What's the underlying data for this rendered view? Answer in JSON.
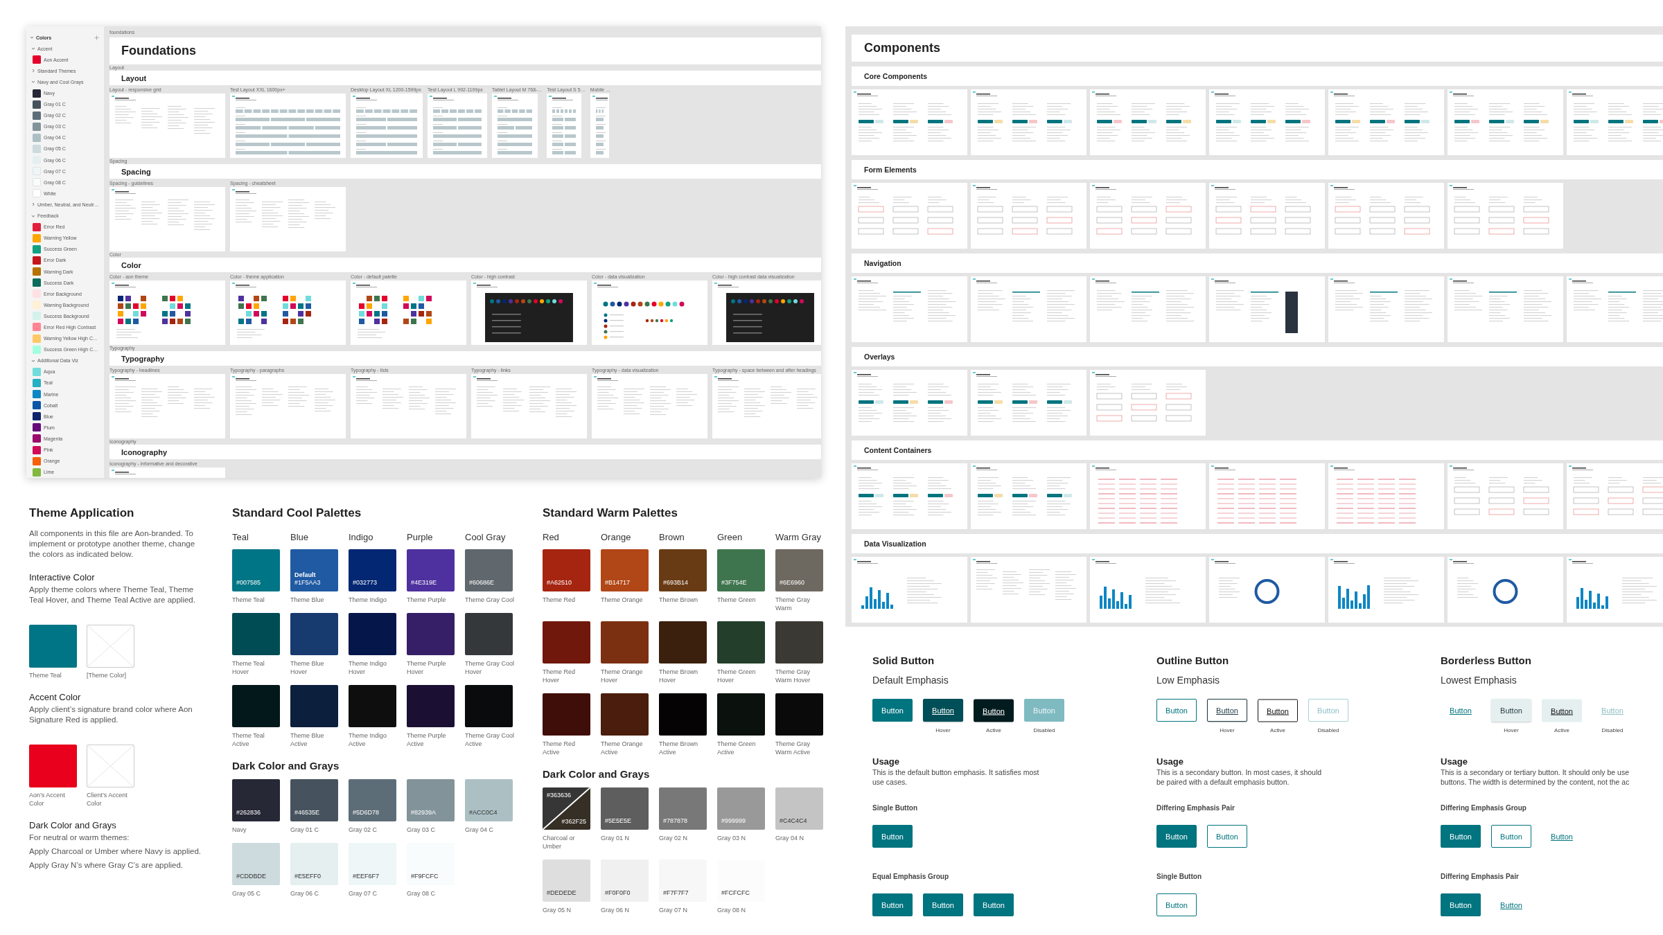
{
  "sidebar": {
    "title": "Colors",
    "expanded": true,
    "groups": [
      {
        "label": "Accent",
        "expanded": true,
        "items": [
          {
            "name": "Aon Accent",
            "color": "#e4002b"
          }
        ]
      },
      {
        "label": "Standard Themes",
        "expanded": false
      },
      {
        "label": "Navy and Cool Grays",
        "expanded": true,
        "items": [
          {
            "name": "Navy",
            "color": "#262836"
          },
          {
            "name": "Gray 01 C",
            "color": "#46535e"
          },
          {
            "name": "Gray 02 C",
            "color": "#5d6d78"
          },
          {
            "name": "Gray 03 C",
            "color": "#82939a"
          },
          {
            "name": "Gray 04 C",
            "color": "#acc0c4"
          },
          {
            "name": "Gray 05 C",
            "color": "#cddbde"
          },
          {
            "name": "Gray 06 C",
            "color": "#e5eff0"
          },
          {
            "name": "Gray 07 C",
            "color": "#eef6f7"
          },
          {
            "name": "Gray 08 C",
            "color": "#f9fcfc"
          },
          {
            "name": "White",
            "color": "#ffffff"
          }
        ]
      },
      {
        "label": "Umber, Neutral, and Neutr…",
        "expanded": false
      },
      {
        "label": "Feedback",
        "expanded": true,
        "items": [
          {
            "name": "Error Red",
            "color": "#e11f3c"
          },
          {
            "name": "Warning Yellow",
            "color": "#ffa600"
          },
          {
            "name": "Success Green",
            "color": "#12a182"
          },
          {
            "name": "Error Dark",
            "color": "#c4151c"
          },
          {
            "name": "Warning Dark",
            "color": "#b67300"
          },
          {
            "name": "Success Dark",
            "color": "#0b6e5c"
          },
          {
            "name": "Error Background",
            "color": "#fde1e3"
          },
          {
            "name": "Warning Background",
            "color": "#fff0d6"
          },
          {
            "name": "Success Background",
            "color": "#d3f2eb"
          },
          {
            "name": "Error Red High Contrast",
            "color": "#ff8593"
          },
          {
            "name": "Warning Yellow High C…",
            "color": "#ffc866"
          },
          {
            "name": "Success Green High C…",
            "color": "#a3ffe1"
          }
        ]
      },
      {
        "label": "Additional Data Viz",
        "expanded": true,
        "items": [
          {
            "name": "Aqua",
            "color": "#70dcdb"
          },
          {
            "name": "Teal",
            "color": "#27afc2"
          },
          {
            "name": "Marine",
            "color": "#0d86c4"
          },
          {
            "name": "Cobalt",
            "color": "#0955a8"
          },
          {
            "name": "Blue",
            "color": "#10236b"
          },
          {
            "name": "Plum",
            "color": "#660a79"
          },
          {
            "name": "Magenta",
            "color": "#9b0a6c"
          },
          {
            "name": "Pink",
            "color": "#d10a59"
          },
          {
            "name": "Orange",
            "color": "#f4600b"
          },
          {
            "name": "Lime",
            "color": "#83b93e"
          }
        ]
      }
    ]
  },
  "foundations": {
    "breadcrumb": "foundations",
    "title": "Foundations",
    "title_caption": "Layout",
    "sections": [
      {
        "title": "Layout",
        "caption": "Spacing",
        "frames": [
          {
            "label": "Layout - responsive grid",
            "kind": "doc"
          },
          {
            "label": "Test Layout XXL 1600px+",
            "kind": "grid-xxl"
          },
          {
            "label": "Desktop Layout XL 1200-1599px",
            "kind": "grid-xl"
          },
          {
            "label": "Test Layout L 992-1199px",
            "kind": "grid-l"
          },
          {
            "label": "Tablet Layout M 768-…",
            "kind": "grid-m"
          },
          {
            "label": "Test Layout S 5…",
            "kind": "grid-s"
          },
          {
            "label": "Mobile …",
            "kind": "grid-xs"
          }
        ]
      },
      {
        "title": "Spacing",
        "caption": "Color",
        "frames": [
          {
            "label": "Spacing - guidelines",
            "kind": "doc"
          },
          {
            "label": "Spacing - cheatsheet",
            "kind": "doc"
          }
        ]
      },
      {
        "title": "Color",
        "caption": "Typography",
        "frames": [
          {
            "label": "Color - aon theme",
            "kind": "swatches"
          },
          {
            "label": "Color - theme application",
            "kind": "swatches"
          },
          {
            "label": "Color - default palette",
            "kind": "swatches"
          },
          {
            "label": "Color - high contrast",
            "kind": "dark"
          },
          {
            "label": "Color - data visualization",
            "kind": "dots"
          },
          {
            "label": "Color - high contrast data visualization",
            "kind": "dark"
          }
        ]
      },
      {
        "title": "Typography",
        "caption": "Iconography",
        "frames": [
          {
            "label": "Typography - headlines",
            "kind": "doc"
          },
          {
            "label": "Typography - paragraphs",
            "kind": "doc"
          },
          {
            "label": "Typography - lists",
            "kind": "doc"
          },
          {
            "label": "Typography - links",
            "kind": "doc"
          },
          {
            "label": "Typography - data visualization",
            "kind": "doc"
          },
          {
            "label": "Typography - space between and after headings",
            "kind": "doc"
          }
        ]
      },
      {
        "title": "Iconography",
        "frames": [
          {
            "label": "Iconography - informative and decorative",
            "kind": "doc"
          }
        ]
      }
    ]
  },
  "components": {
    "title": "Components",
    "sections": [
      {
        "title": "Core Components",
        "frames": [
          {
            "kind": "ui"
          },
          {
            "kind": "ui"
          },
          {
            "kind": "ui"
          },
          {
            "kind": "ui"
          },
          {
            "kind": "ui"
          },
          {
            "kind": "ui"
          },
          {
            "kind": "ui"
          }
        ]
      },
      {
        "title": "Form Elements",
        "frames": [
          {
            "kind": "form"
          },
          {
            "kind": "form"
          },
          {
            "kind": "form"
          },
          {
            "kind": "form"
          },
          {
            "kind": "form"
          },
          {
            "kind": "form"
          }
        ]
      },
      {
        "title": "Navigation",
        "frames": [
          {
            "kind": "nav"
          },
          {
            "kind": "nav"
          },
          {
            "kind": "nav"
          },
          {
            "kind": "nav"
          },
          {
            "kind": "nav"
          },
          {
            "kind": "nav"
          },
          {
            "kind": "nav"
          }
        ]
      },
      {
        "title": "Overlays",
        "frames": [
          {
            "kind": "ui"
          },
          {
            "kind": "ui"
          },
          {
            "kind": "form"
          }
        ]
      },
      {
        "title": "Content Containers",
        "frames": [
          {
            "kind": "ui"
          },
          {
            "kind": "ui"
          },
          {
            "kind": "table"
          },
          {
            "kind": "table"
          },
          {
            "kind": "table"
          },
          {
            "kind": "form"
          },
          {
            "kind": "form"
          }
        ]
      },
      {
        "title": "Data Visualization",
        "frames": [
          {
            "kind": "chart"
          },
          {
            "kind": "doc"
          },
          {
            "kind": "chart"
          },
          {
            "kind": "chart"
          },
          {
            "kind": "chart"
          },
          {
            "kind": "chart"
          },
          {
            "kind": "chart"
          }
        ]
      }
    ]
  },
  "theme_application": {
    "title": "Theme Application",
    "intro": "All components in this file are Aon-branded. To implement or prototype another theme, change the colors as indicated below.",
    "sections": [
      {
        "heading": "Interactive Color",
        "paragraphs": [
          "Apply theme colors where Theme Teal, Theme Teal Hover, and Theme Teal Active are applied."
        ],
        "swatches": [
          {
            "kind": "color",
            "color": "#007585",
            "label": "Theme Teal"
          },
          {
            "kind": "placeholder",
            "label": "[Theme Color]"
          }
        ]
      },
      {
        "heading": "Accent Color",
        "paragraphs": [
          "Apply client’s signature brand color where Aon Signature Red is applied."
        ],
        "swatches": [
          {
            "kind": "color",
            "color": "#e8001c",
            "label": "Aon’s Accent Color"
          },
          {
            "kind": "placeholder",
            "label": "Client’s Accent Color"
          }
        ]
      },
      {
        "heading": "Dark Color and Grays",
        "paragraphs": [
          "For neutral or warm themes:",
          "Apply Charcoal or Umber where Navy is applied.",
          "Apply Gray N’s where Gray C’s are applied."
        ]
      }
    ]
  },
  "cool_palettes": {
    "title": "Standard Cool Palettes",
    "columns": [
      {
        "name": "Teal",
        "swatches": [
          {
            "color": "#007585",
            "hex": "#007585",
            "label": "Theme Teal"
          },
          {
            "color": "#004c55",
            "label": "Theme Teal Hover"
          },
          {
            "color": "#02181b",
            "label": "Theme Teal Active"
          }
        ]
      },
      {
        "name": "Blue",
        "swatches": [
          {
            "color": "#1f5aa3",
            "hex": "#1F5AA3",
            "tag": "Default",
            "label": "Theme Blue"
          },
          {
            "color": "#173a6f",
            "label": "Theme Blue Hover"
          },
          {
            "color": "#0c1f3c",
            "label": "Theme Blue Active"
          }
        ]
      },
      {
        "name": "Indigo",
        "swatches": [
          {
            "color": "#032773",
            "hex": "#032773",
            "label": "Theme Indigo"
          },
          {
            "color": "#04164a",
            "label": "Theme Indigo Hover"
          },
          {
            "color": "#0e0e0e",
            "label": "Theme Indigo Active"
          }
        ]
      },
      {
        "name": "Purple",
        "swatches": [
          {
            "color": "#4e319e",
            "hex": "#4E319E",
            "label": "Theme Purple"
          },
          {
            "color": "#361f67",
            "label": "Theme Purple Hover"
          },
          {
            "color": "#1b1033",
            "label": "Theme Purple Active"
          }
        ]
      },
      {
        "name": "Cool Gray",
        "swatches": [
          {
            "color": "#60686e",
            "hex": "#60686E",
            "label": "Theme Gray Cool"
          },
          {
            "color": "#34383b",
            "label": "Theme Gray Cool Hover"
          },
          {
            "color": "#0a0b0c",
            "label": "Theme Gray Cool Active"
          }
        ]
      }
    ],
    "grays_title": "Dark Color and Grays",
    "grays": [
      {
        "kind": "solid",
        "color": "#262836",
        "hex": "#262836",
        "label": "Navy"
      },
      {
        "kind": "solid",
        "color": "#46535e",
        "hex": "#46535E",
        "label": "Gray 01 C"
      },
      {
        "kind": "solid",
        "color": "#5d6d78",
        "hex": "#5D6D78",
        "label": "Gray 02 C"
      },
      {
        "kind": "solid",
        "color": "#82939a",
        "hex": "#82939A",
        "label": "Gray 03 C"
      },
      {
        "kind": "solid",
        "color": "#acc0c4",
        "hex": "#ACC0C4",
        "label": "Gray 04 C"
      },
      {
        "kind": "solid",
        "color": "#cddbde",
        "hex": "#CDDBDE",
        "label": "Gray 05 C"
      },
      {
        "kind": "solid",
        "color": "#e5eff0",
        "hex": "#E5EFF0",
        "label": "Gray 06 C"
      },
      {
        "kind": "solid",
        "color": "#eef6f7",
        "hex": "#EEF6F7",
        "label": "Gray 07 C"
      },
      {
        "kind": "solid",
        "color": "#f9fcfc",
        "hex": "#F9FCFC",
        "label": "Gray 08 C"
      }
    ]
  },
  "warm_palettes": {
    "title": "Standard Warm Palettes",
    "columns": [
      {
        "name": "Red",
        "swatches": [
          {
            "color": "#a62510",
            "hex": "#A62510",
            "label": "Theme Red"
          },
          {
            "color": "#70180c",
            "label": "Theme Red Hover"
          },
          {
            "color": "#400e08",
            "label": "Theme Red Active"
          }
        ]
      },
      {
        "name": "Orange",
        "swatches": [
          {
            "color": "#b14717",
            "hex": "#B14717",
            "label": "Theme Orange"
          },
          {
            "color": "#7c3012",
            "label": "Theme Orange Hover"
          },
          {
            "color": "#4b1d0c",
            "label": "Theme Orange Active"
          }
        ]
      },
      {
        "name": "Brown",
        "swatches": [
          {
            "color": "#693b14",
            "hex": "#693B14",
            "label": "Theme Brown"
          },
          {
            "color": "#3a200d",
            "label": "Theme Brown Hover"
          },
          {
            "color": "#050303",
            "label": "Theme Brown Active"
          }
        ]
      },
      {
        "name": "Green",
        "swatches": [
          {
            "color": "#3f754e",
            "hex": "#3F754E",
            "label": "Theme Green"
          },
          {
            "color": "#233f2b",
            "label": "Theme Green Hover"
          },
          {
            "color": "#0b110d",
            "label": "Theme Green Active"
          }
        ]
      },
      {
        "name": "Warm Gray",
        "swatches": [
          {
            "color": "#6e6960",
            "hex": "#6E6960",
            "label": "Theme Gray Warm"
          },
          {
            "color": "#3b3934",
            "label": "Theme Gray Warm Hover"
          },
          {
            "color": "#0b0a0b",
            "label": "Theme Gray Warm Active"
          }
        ]
      }
    ],
    "grays_title": "Dark Color and Grays",
    "grays": [
      {
        "kind": "split",
        "halves": [
          {
            "color": "#363636",
            "hex": "#363636"
          },
          {
            "color": "#362f25",
            "hex": "#362F25"
          }
        ],
        "label": "Charcoal or Umber"
      },
      {
        "kind": "solid",
        "color": "#5e5e5e",
        "hex": "#5E5E5E",
        "label": "Gray 01 N"
      },
      {
        "kind": "solid",
        "color": "#787878",
        "hex": "#787878",
        "label": "Gray 02 N"
      },
      {
        "kind": "solid",
        "color": "#999999",
        "hex": "#999999",
        "label": "Gray 03 N"
      },
      {
        "kind": "solid",
        "color": "#c4c4c4",
        "hex": "#C4C4C4",
        "label": "Gray 04 N"
      },
      {
        "kind": "solid",
        "color": "#dedede",
        "hex": "#DEDEDE",
        "label": "Gray 05 N"
      },
      {
        "kind": "solid",
        "color": "#f0f0f0",
        "hex": "#F0F0F0",
        "label": "Gray 06 N"
      },
      {
        "kind": "solid",
        "color": "#f7f7f7",
        "hex": "#F7F7F7",
        "label": "Gray 07 N"
      },
      {
        "kind": "solid",
        "color": "#fcfcfc",
        "hex": "#FCFCFC",
        "label": "Gray 08 N"
      }
    ]
  },
  "button_types": [
    {
      "title": "Solid Button",
      "subtitle": "Default Emphasis",
      "kind": "solid",
      "states": [
        {
          "label": "Button",
          "hover": false,
          "active": false,
          "disabled": false
        },
        {
          "label": "Button",
          "hover": true,
          "active": false,
          "disabled": false,
          "caption": "Hover"
        },
        {
          "label": "Button",
          "hover": false,
          "active": true,
          "disabled": false,
          "caption": "Active"
        },
        {
          "label": "Button",
          "hover": false,
          "active": false,
          "disabled": true,
          "caption": "Disabled"
        }
      ],
      "usage_title": "Usage",
      "usage_lines": [
        "This is the default button emphasis. It satisfies most",
        "use cases."
      ],
      "examples": [
        {
          "title": "Single Button",
          "buttons": [
            {
              "label": "Button",
              "kind": "solid"
            }
          ]
        },
        {
          "title": "Equal Emphasis Group",
          "buttons": [
            {
              "label": "Button",
              "kind": "solid"
            },
            {
              "label": "Button",
              "kind": "solid"
            },
            {
              "label": "Button",
              "kind": "solid"
            }
          ]
        }
      ]
    },
    {
      "title": "Outline Button",
      "subtitle": "Low Emphasis",
      "kind": "outline",
      "states": [
        {
          "label": "Button",
          "hover": false,
          "active": false,
          "disabled": false
        },
        {
          "label": "Button",
          "hover": true,
          "active": false,
          "disabled": false,
          "caption": "Hover"
        },
        {
          "label": "Button",
          "hover": false,
          "active": true,
          "disabled": false,
          "caption": "Active"
        },
        {
          "label": "Button",
          "hover": false,
          "active": false,
          "disabled": true,
          "caption": "Disabled"
        }
      ],
      "usage_title": "Usage",
      "usage_lines": [
        "This is a secondary button. In most cases, it should",
        "be paired with a default emphasis button."
      ],
      "examples": [
        {
          "title": "Differing Emphasis Pair",
          "buttons": [
            {
              "label": "Button",
              "kind": "solid"
            },
            {
              "label": "Button",
              "kind": "outline"
            }
          ]
        },
        {
          "title": "Single Button",
          "buttons": [
            {
              "label": "Button",
              "kind": "outline"
            }
          ]
        }
      ]
    },
    {
      "title": "Borderless Button",
      "subtitle": "Lowest Emphasis",
      "kind": "borderless",
      "states": [
        {
          "label": "Button",
          "hover": false,
          "active": false,
          "disabled": false
        },
        {
          "label": "Button",
          "hover": true,
          "active": false,
          "disabled": false,
          "caption": "Hover"
        },
        {
          "label": "Button",
          "hover": false,
          "active": true,
          "disabled": false,
          "caption": "Active"
        },
        {
          "label": "Button",
          "hover": false,
          "active": false,
          "disabled": true,
          "caption": "Disabled"
        }
      ],
      "usage_title": "Usage",
      "usage_lines": [
        "This is a secondary or tertiary button. It should only be use",
        "buttons. The width is determined by the content, not the ac"
      ],
      "examples": [
        {
          "title": "Differing Emphasis Group",
          "buttons": [
            {
              "label": "Button",
              "kind": "solid"
            },
            {
              "label": "Button",
              "kind": "outline"
            },
            {
              "label": "Button",
              "kind": "borderless"
            }
          ]
        },
        {
          "title": "Differing Emphasis Pair",
          "buttons": [
            {
              "label": "Button",
              "kind": "solid"
            },
            {
              "label": "Button",
              "kind": "borderless"
            }
          ]
        }
      ]
    }
  ]
}
